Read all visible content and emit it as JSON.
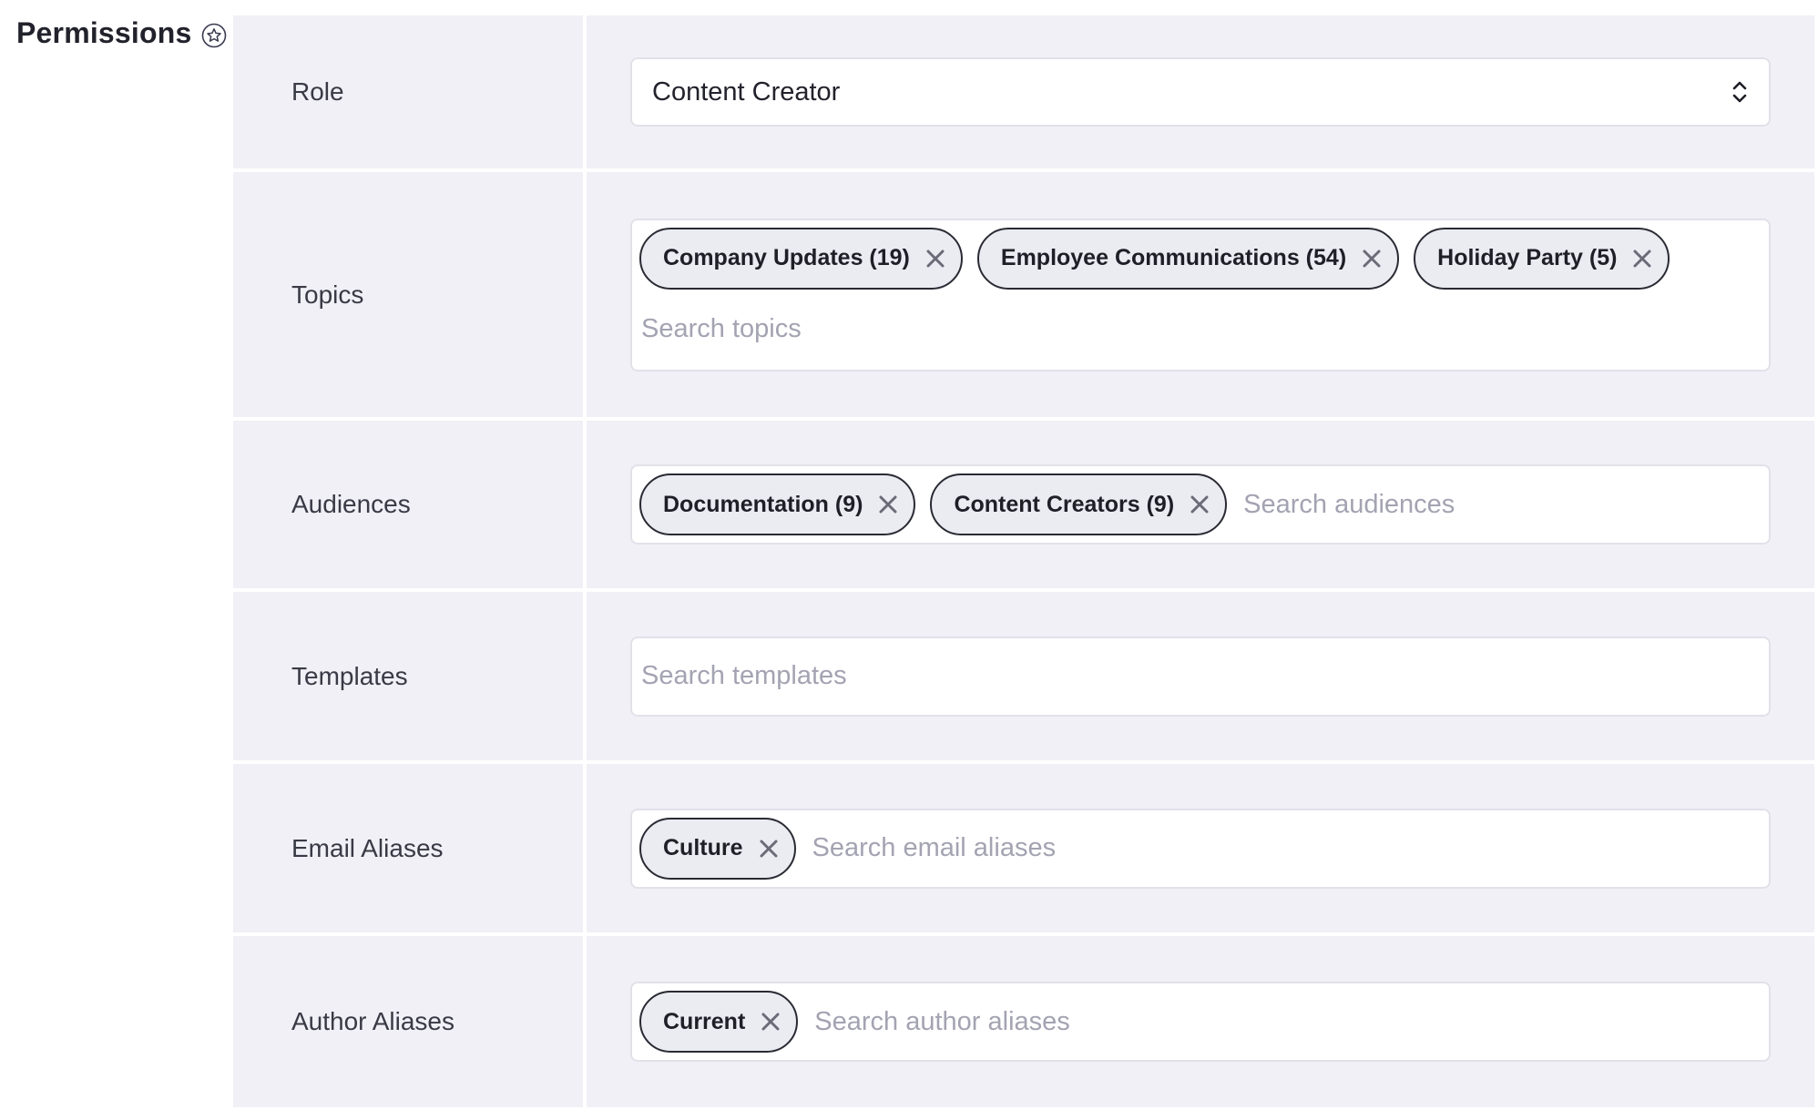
{
  "section": {
    "title": "Permissions",
    "icon": "star-icon"
  },
  "rows": {
    "role": {
      "label": "Role",
      "selected": "Content Creator",
      "icon": "chevron-up-down-icon"
    },
    "topics": {
      "label": "Topics",
      "chips": [
        "Company Updates (19)",
        "Employee Communications (54)",
        "Holiday Party (5)"
      ],
      "placeholder": "Search topics"
    },
    "audiences": {
      "label": "Audiences",
      "chips": [
        "Documentation (9)",
        "Content Creators (9)"
      ],
      "placeholder": "Search audiences"
    },
    "templates": {
      "label": "Templates",
      "chips": [],
      "placeholder": "Search templates"
    },
    "email_aliases": {
      "label": "Email Aliases",
      "chips": [
        "Culture"
      ],
      "placeholder": "Search email aliases"
    },
    "author_aliases": {
      "label": "Author Aliases",
      "chips": [
        "Current"
      ],
      "placeholder": "Search author aliases"
    }
  },
  "colors": {
    "row_background": "#f0f0f6",
    "chip_background": "#ebebf2",
    "chip_border": "#2a2a34",
    "placeholder": "#a3a3b2"
  }
}
